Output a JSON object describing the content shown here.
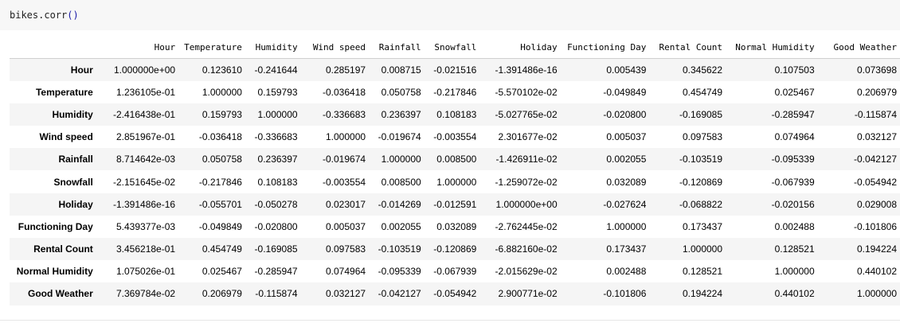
{
  "code": {
    "text": "bikes.corr",
    "open_paren": "(",
    "close_paren": ")"
  },
  "table": {
    "columns": [
      "Hour",
      "Temperature",
      "Humidity",
      "Wind speed",
      "Rainfall",
      "Snowfall",
      "Holiday",
      "Functioning Day",
      "Rental Count",
      "Normal Humidity",
      "Good Weather"
    ],
    "rows": [
      {
        "label": "Hour",
        "values": [
          "1.000000e+00",
          "0.123610",
          "-0.241644",
          "0.285197",
          "0.008715",
          "-0.021516",
          "-1.391486e-16",
          "0.005439",
          "0.345622",
          "0.107503",
          "0.073698"
        ]
      },
      {
        "label": "Temperature",
        "values": [
          "1.236105e-01",
          "1.000000",
          "0.159793",
          "-0.036418",
          "0.050758",
          "-0.217846",
          "-5.570102e-02",
          "-0.049849",
          "0.454749",
          "0.025467",
          "0.206979"
        ]
      },
      {
        "label": "Humidity",
        "values": [
          "-2.416438e-01",
          "0.159793",
          "1.000000",
          "-0.336683",
          "0.236397",
          "0.108183",
          "-5.027765e-02",
          "-0.020800",
          "-0.169085",
          "-0.285947",
          "-0.115874"
        ]
      },
      {
        "label": "Wind speed",
        "values": [
          "2.851967e-01",
          "-0.036418",
          "-0.336683",
          "1.000000",
          "-0.019674",
          "-0.003554",
          "2.301677e-02",
          "0.005037",
          "0.097583",
          "0.074964",
          "0.032127"
        ]
      },
      {
        "label": "Rainfall",
        "values": [
          "8.714642e-03",
          "0.050758",
          "0.236397",
          "-0.019674",
          "1.000000",
          "0.008500",
          "-1.426911e-02",
          "0.002055",
          "-0.103519",
          "-0.095339",
          "-0.042127"
        ]
      },
      {
        "label": "Snowfall",
        "values": [
          "-2.151645e-02",
          "-0.217846",
          "0.108183",
          "-0.003554",
          "0.008500",
          "1.000000",
          "-1.259072e-02",
          "0.032089",
          "-0.120869",
          "-0.067939",
          "-0.054942"
        ]
      },
      {
        "label": "Holiday",
        "values": [
          "-1.391486e-16",
          "-0.055701",
          "-0.050278",
          "0.023017",
          "-0.014269",
          "-0.012591",
          "1.000000e+00",
          "-0.027624",
          "-0.068822",
          "-0.020156",
          "0.029008"
        ]
      },
      {
        "label": "Functioning Day",
        "values": [
          "5.439377e-03",
          "-0.049849",
          "-0.020800",
          "0.005037",
          "0.002055",
          "0.032089",
          "-2.762445e-02",
          "1.000000",
          "0.173437",
          "0.002488",
          "-0.101806"
        ]
      },
      {
        "label": "Rental Count",
        "values": [
          "3.456218e-01",
          "0.454749",
          "-0.169085",
          "0.097583",
          "-0.103519",
          "-0.120869",
          "-6.882160e-02",
          "0.173437",
          "1.000000",
          "0.128521",
          "0.194224"
        ]
      },
      {
        "label": "Normal Humidity",
        "values": [
          "1.075026e-01",
          "0.025467",
          "-0.285947",
          "0.074964",
          "-0.095339",
          "-0.067939",
          "-2.015629e-02",
          "0.002488",
          "0.128521",
          "1.000000",
          "0.440102"
        ]
      },
      {
        "label": "Good Weather",
        "values": [
          "7.369784e-02",
          "0.206979",
          "-0.115874",
          "0.032127",
          "-0.042127",
          "-0.054942",
          "2.900771e-02",
          "-0.101806",
          "0.194224",
          "0.440102",
          "1.000000"
        ]
      }
    ]
  }
}
